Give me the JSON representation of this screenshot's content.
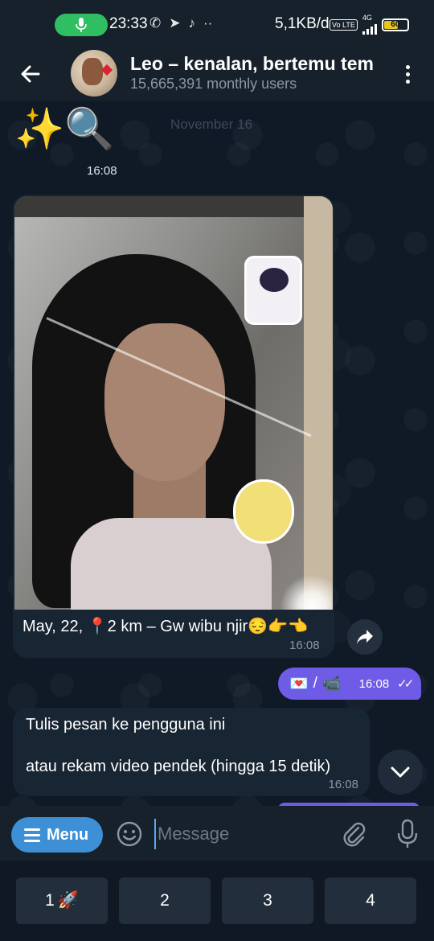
{
  "status_bar": {
    "time": "23:33",
    "icons": [
      "phone-icon",
      "telegram-icon",
      "tiktok-icon",
      "more-dots"
    ],
    "network_speed": "5,1KB/d",
    "network_type": "4G",
    "volte_label": "Vo LTE",
    "battery": "60",
    "battery_level": 0.6,
    "battery_color": "#e8c41c",
    "mic_indicator_color": "#2fbf62"
  },
  "header": {
    "title": "Leo – kenalan, bertemu tem",
    "subtitle": "15,665,391 monthly users"
  },
  "chat": {
    "date_chip": "November 16",
    "sticker": {
      "emojis": "✨🔍",
      "time": "16:08"
    },
    "photo_message": {
      "caption": "May, 22, 📍2 km – Gw wibu njir😔👉👈",
      "time": "16:08"
    },
    "outgoing_message": {
      "emoji_1": "💌",
      "separator": "/",
      "emoji_2": "📹",
      "time": "16:08",
      "status": "read"
    },
    "incoming_message": {
      "line_1": "Tulis pesan ke pengguna ini",
      "line_2": "atau rekam video pendek (hingga 15 detik)",
      "time": "16:08"
    }
  },
  "input_bar": {
    "menu_label": "Menu",
    "placeholder": "Message",
    "accent_color": "#3d8fd6"
  },
  "bot_keyboard": {
    "keys": [
      {
        "label": "1",
        "emoji": "🚀"
      },
      {
        "label": "2",
        "emoji": ""
      },
      {
        "label": "3",
        "emoji": ""
      },
      {
        "label": "4",
        "emoji": ""
      }
    ]
  },
  "colors": {
    "outgoing_bubble": "#6e5ce6",
    "incoming_bubble": "#182533",
    "chat_background": "#0e1621"
  }
}
